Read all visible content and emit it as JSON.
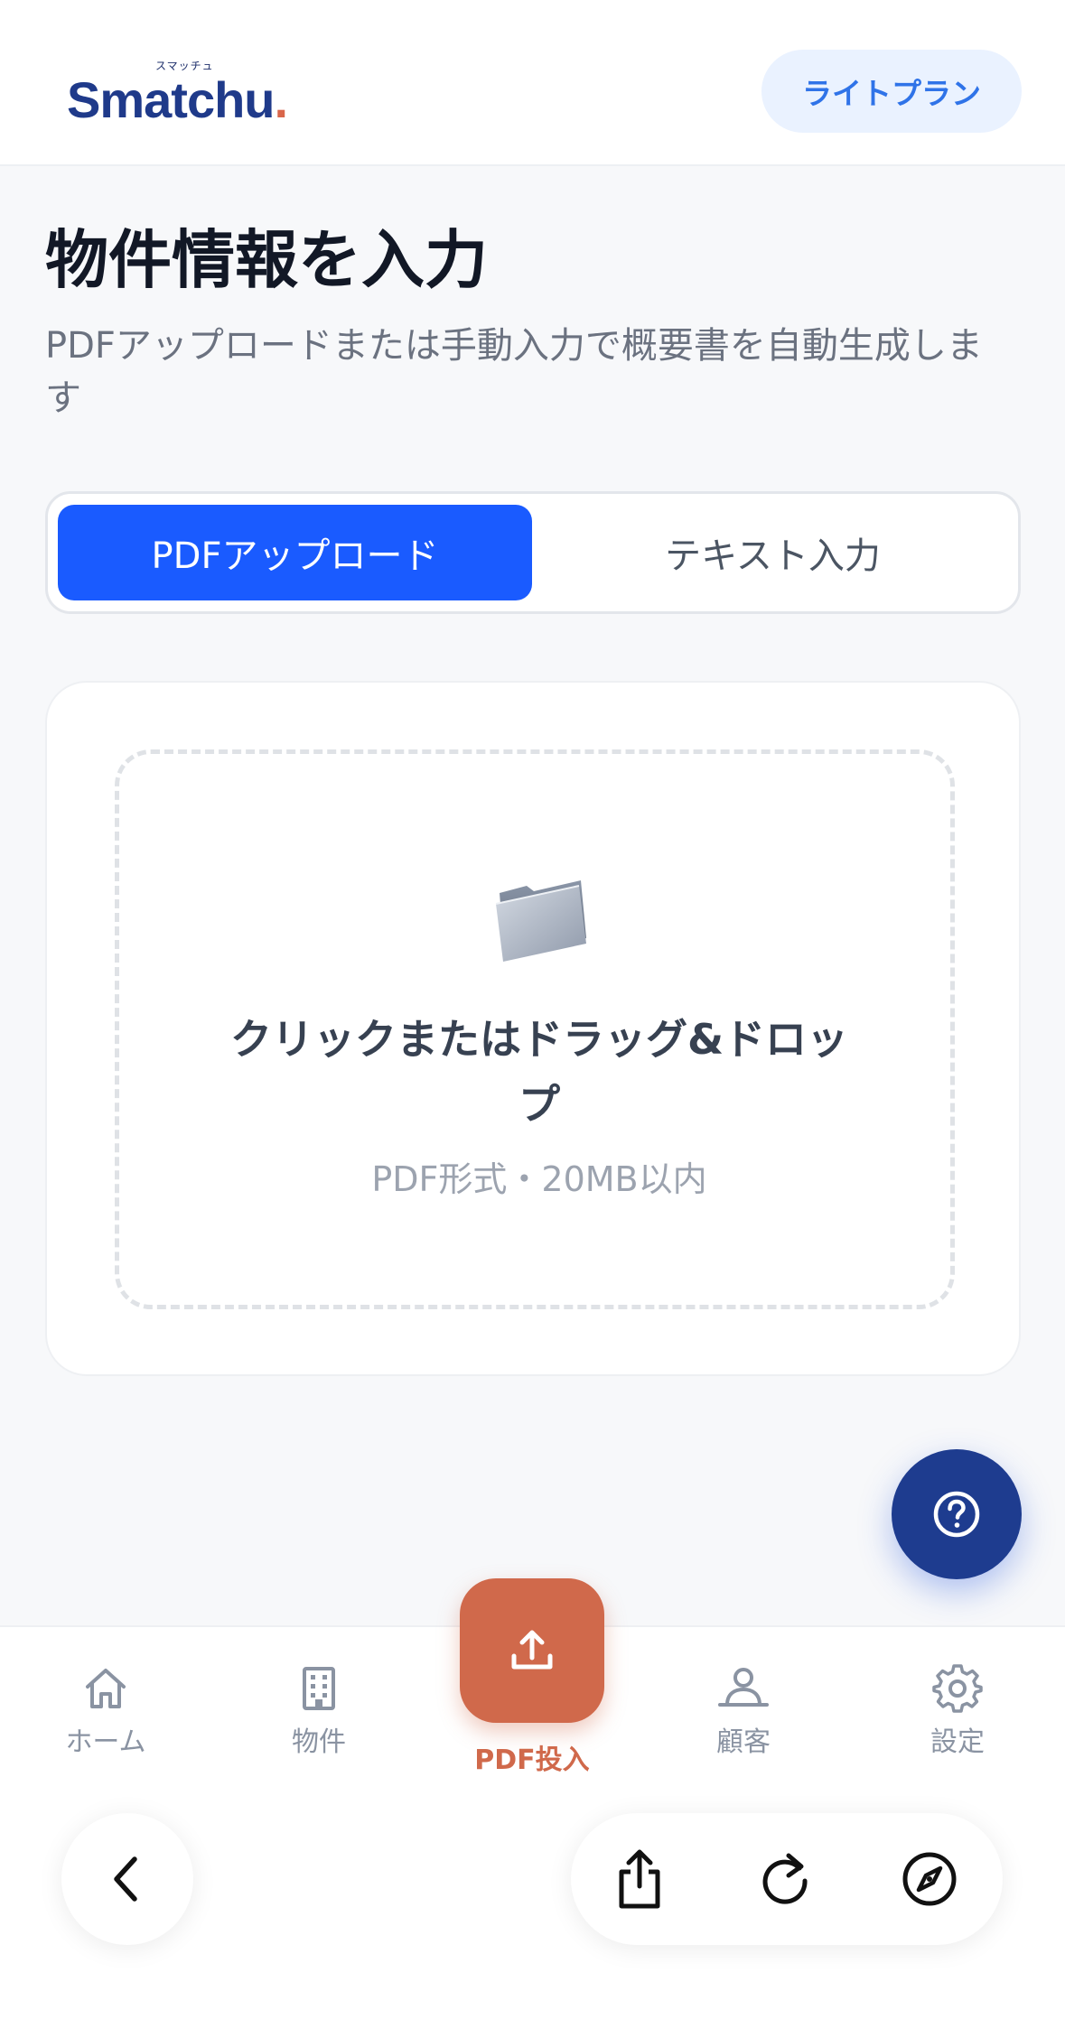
{
  "header": {
    "logo_kana": "スマッチュ",
    "logo_text": "Smatchu",
    "logo_dot": ".",
    "plan_label": "ライトプラン"
  },
  "page": {
    "title": "物件情報を入力",
    "subtitle": "PDFアップロードまたは手動入力で概要書を自動生成します"
  },
  "tabs": [
    {
      "label": "PDFアップロード",
      "active": true
    },
    {
      "label": "テキスト入力",
      "active": false
    }
  ],
  "upload": {
    "icon": "folder-icon",
    "title": "クリックまたはドラッグ&ドロップ",
    "hint": "PDF形式・20MB以内"
  },
  "help": {
    "icon": "help-icon"
  },
  "bottom_nav": {
    "items": [
      {
        "label": "ホーム",
        "icon": "home-icon"
      },
      {
        "label": "物件",
        "icon": "building-icon"
      },
      {
        "label": "PDF投入",
        "icon": "upload-icon"
      },
      {
        "label": "顧客",
        "icon": "customer-icon"
      },
      {
        "label": "設定",
        "icon": "gear-icon"
      }
    ]
  },
  "browser_toolbar": {
    "icons": [
      "back-icon",
      "share-icon",
      "reload-icon",
      "compass-icon"
    ]
  },
  "colors": {
    "primary": "#1a5bff",
    "brand_navy": "#1f3a8a",
    "accent_orange": "#d0694b",
    "plan_badge_bg": "#eaf2ff"
  }
}
